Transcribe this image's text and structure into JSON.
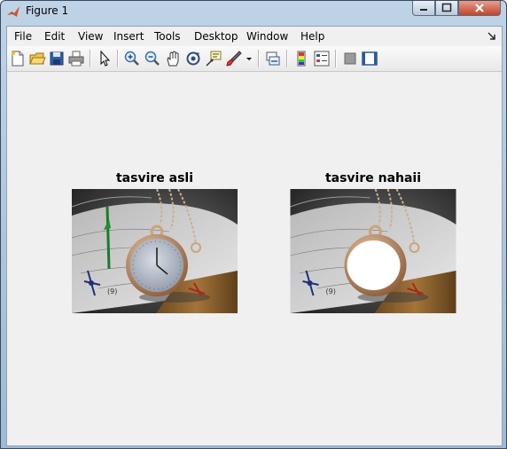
{
  "window": {
    "title": "Figure 1"
  },
  "menu": [
    "File",
    "Edit",
    "View",
    "Insert",
    "Tools",
    "Desktop",
    "Window",
    "Help"
  ],
  "toolbar": {
    "icons": [
      "new-figure-icon",
      "open-file-icon",
      "save-icon",
      "print-icon",
      "edit-plot-icon",
      "zoom-in-icon",
      "zoom-out-icon",
      "pan-icon",
      "rotate-3d-icon",
      "data-cursor-icon",
      "brush-icon",
      "link-plot-icon",
      "insert-colorbar-icon",
      "insert-legend-icon",
      "hide-plot-tools-icon",
      "show-plot-tools-icon"
    ]
  },
  "axes": [
    {
      "title": "tasvire asli"
    },
    {
      "title": "tasvire nahaii"
    }
  ],
  "colors": {
    "accent": "#c2442b",
    "titlebar": "#bfd3e6"
  }
}
